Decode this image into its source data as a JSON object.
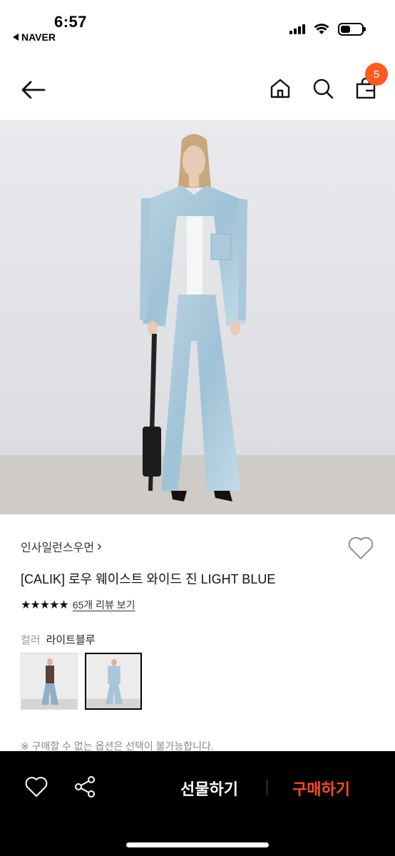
{
  "status_bar": {
    "time": "6:57",
    "back_app": "NAVER"
  },
  "nav": {
    "cart_count": "5"
  },
  "product": {
    "brand": "인사일런스우먼",
    "brand_chevron": "›",
    "title": "[CALIK] 로우 웨이스트 와이드 진 LIGHT BLUE",
    "stars": "★★★★★",
    "review_link": "65개 리뷰 보기",
    "color_label": "컬러",
    "color_value": "라이트블루",
    "notice": "※ 구매할 수 없는 옵션은 선택이 불가능합니다."
  },
  "bottom_bar": {
    "gift_label": "선물하기",
    "buy_label": "구매하기"
  },
  "colors": {
    "accent": "#ff5a1f",
    "buy": "#ff4a1c",
    "bar": "#000000"
  }
}
